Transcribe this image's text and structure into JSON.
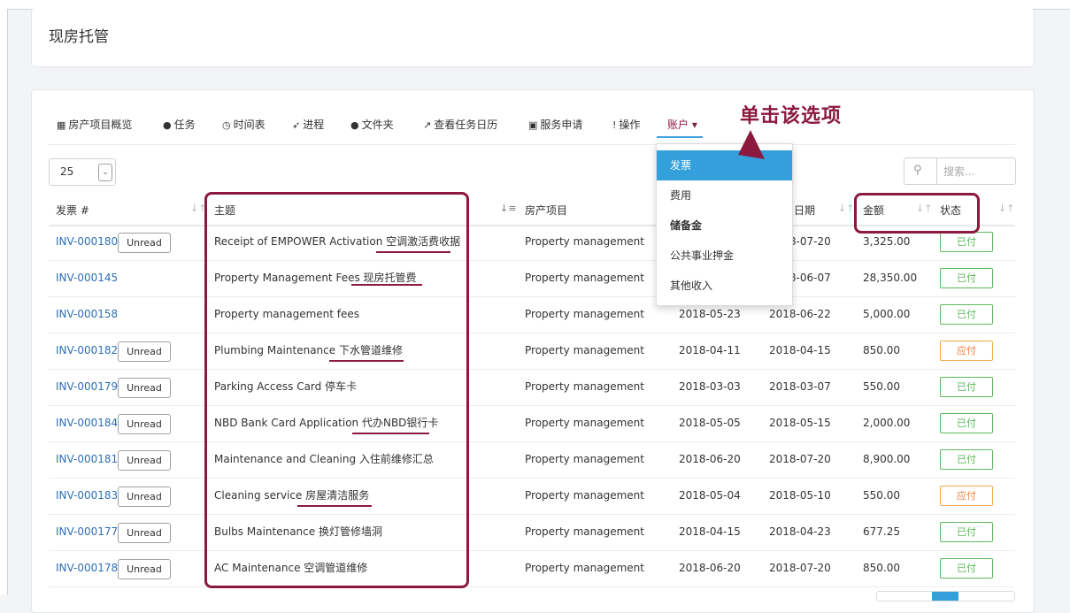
{
  "page": {
    "title": "现房托管"
  },
  "tabs": [
    {
      "icon": "grid-icon",
      "glyph": "▦",
      "label": "房产项目概览"
    },
    {
      "icon": "check-circle-icon",
      "glyph": "●",
      "label": "任务"
    },
    {
      "icon": "clock-icon",
      "glyph": "◷",
      "label": "时间表"
    },
    {
      "icon": "rocket-icon",
      "glyph": "➶",
      "label": "进程"
    },
    {
      "icon": "comment-icon",
      "glyph": "●",
      "label": "文件夹"
    },
    {
      "icon": "line-chart-icon",
      "glyph": "↗",
      "label": "查看任务日历"
    },
    {
      "icon": "id-card-icon",
      "glyph": "▣",
      "label": "服务申请"
    },
    {
      "icon": "exclamation-icon",
      "glyph": "!",
      "label": "操作"
    },
    {
      "icon": "caret-down-icon",
      "glyph": "",
      "label": "账户 ▾"
    }
  ],
  "length_select": {
    "value": "25"
  },
  "search": {
    "placeholder": "搜索..."
  },
  "table": {
    "headers": {
      "invoice": "发票 #",
      "subject": "主题",
      "project": "房产项目",
      "date_col": "日期",
      "amount": "金额",
      "status": "状态"
    },
    "unread_label": "Unread",
    "rows": [
      {
        "invoice": "INV-000180",
        "unread": true,
        "subject": "Receipt of EMPOWER Activation 空调激活费收据",
        "project": "Property management",
        "date1": "",
        "date2": "2018-07-20",
        "amount": "3,325.00",
        "status": "已付",
        "status_type": "paid"
      },
      {
        "invoice": "INV-000145",
        "unread": false,
        "subject": "Property Management Fees 现房托管费",
        "project": "Property management",
        "date1": "",
        "date2": "2018-06-07",
        "amount": "28,350.00",
        "status": "已付",
        "status_type": "paid"
      },
      {
        "invoice": "INV-000158",
        "unread": false,
        "subject": "Property management fees",
        "project": "Property management",
        "date1": "2018-05-23",
        "date2": "2018-06-22",
        "amount": "5,000.00",
        "status": "已付",
        "status_type": "paid"
      },
      {
        "invoice": "INV-000182",
        "unread": true,
        "subject": "Plumbing Maintenance 下水管道维修",
        "project": "Property management",
        "date1": "2018-04-11",
        "date2": "2018-04-15",
        "amount": "850.00",
        "status": "应付",
        "status_type": "due"
      },
      {
        "invoice": "INV-000179",
        "unread": true,
        "subject": "Parking Access Card 停车卡",
        "project": "Property management",
        "date1": "2018-03-03",
        "date2": "2018-03-07",
        "amount": "550.00",
        "status": "已付",
        "status_type": "paid"
      },
      {
        "invoice": "INV-000184",
        "unread": true,
        "subject": "NBD Bank Card Application 代办NBD银行卡",
        "project": "Property management",
        "date1": "2018-05-05",
        "date2": "2018-05-15",
        "amount": "2,000.00",
        "status": "已付",
        "status_type": "paid"
      },
      {
        "invoice": "INV-000181",
        "unread": true,
        "subject": "Maintenance and Cleaning 入住前维修汇总",
        "project": "Property management",
        "date1": "2018-06-20",
        "date2": "2018-07-20",
        "amount": "8,900.00",
        "status": "已付",
        "status_type": "paid"
      },
      {
        "invoice": "INV-000183",
        "unread": true,
        "subject": "Cleaning service 房屋清洁服务",
        "project": "Property management",
        "date1": "2018-05-04",
        "date2": "2018-05-10",
        "amount": "550.00",
        "status": "应付",
        "status_type": "due"
      },
      {
        "invoice": "INV-000177",
        "unread": true,
        "subject": "Bulbs Maintenance 换灯管修墙洞",
        "project": "Property management",
        "date1": "2018-04-15",
        "date2": "2018-04-23",
        "amount": "677.25",
        "status": "已付",
        "status_type": "paid"
      },
      {
        "invoice": "INV-000178",
        "unread": true,
        "subject": "AC Maintenance 空调管道维修",
        "project": "Property management",
        "date1": "2018-06-20",
        "date2": "2018-07-20",
        "amount": "850.00",
        "status": "已付",
        "status_type": "paid"
      }
    ]
  },
  "dropdown": {
    "items": [
      "发票",
      "费用",
      "储备金",
      "公共事业押金",
      "其他收入"
    ],
    "selected": "发票"
  },
  "annotation": {
    "text": "单击该选项",
    "color": "#8b1a3e"
  },
  "colors": {
    "accent_blue": "#33a0dc",
    "link": "#2f6fb5",
    "paid": "#5cb85c",
    "due": "#f0ad4e",
    "annotation": "#8b1a3e"
  }
}
